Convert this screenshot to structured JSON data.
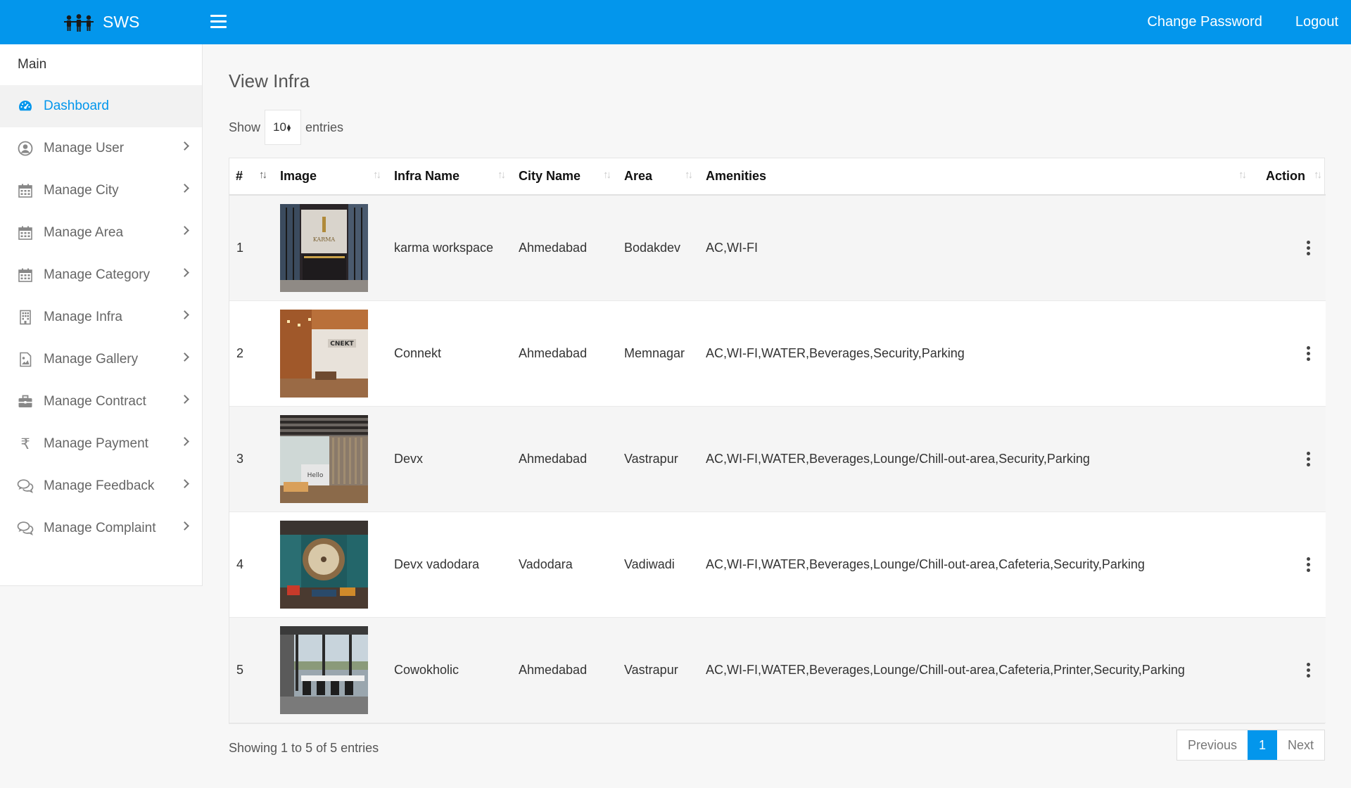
{
  "app": {
    "brand": "SWS",
    "top_links": [
      "Change Password",
      "Logout"
    ]
  },
  "sidebar": {
    "section_title": "Main",
    "items": [
      {
        "label": "Dashboard",
        "icon": "dashboard-icon",
        "active": true
      },
      {
        "label": "Manage User",
        "icon": "user-circle-icon"
      },
      {
        "label": "Manage City",
        "icon": "calendar-icon"
      },
      {
        "label": "Manage Area",
        "icon": "calendar-icon"
      },
      {
        "label": "Manage Category",
        "icon": "calendar-icon"
      },
      {
        "label": "Manage Infra",
        "icon": "building-icon"
      },
      {
        "label": "Manage Gallery",
        "icon": "image-file-icon"
      },
      {
        "label": "Manage Contract",
        "icon": "briefcase-icon"
      },
      {
        "label": "Manage Payment",
        "icon": "rupee-icon"
      },
      {
        "label": "Manage Feedback",
        "icon": "comments-icon"
      },
      {
        "label": "Manage Complaint",
        "icon": "comments-icon"
      }
    ]
  },
  "main": {
    "title": "View Infra",
    "length": {
      "prefix": "Show",
      "value": "10",
      "suffix": "entries"
    },
    "table": {
      "headers": [
        "#",
        "Image",
        "Infra Name",
        "City Name",
        "Area",
        "Amenities",
        "Action"
      ],
      "rows": [
        {
          "num": "1",
          "name": "karma workspace",
          "city": "Ahmedabad",
          "area": "Bodakdev",
          "amenities": "AC,WI-FI",
          "image": "photo-karma-workspace",
          "image_text": "KARMA"
        },
        {
          "num": "2",
          "name": "Connekt",
          "city": "Ahmedabad",
          "area": "Memnagar",
          "amenities": "AC,WI-FI,WATER,Beverages,Security,Parking",
          "image": "photo-connekt",
          "image_text": "CNEKT"
        },
        {
          "num": "3",
          "name": "Devx",
          "city": "Ahmedabad",
          "area": "Vastrapur",
          "amenities": "AC,WI-FI,WATER,Beverages,Lounge/Chill-out-area,Security,Parking",
          "image": "photo-devx",
          "image_text": "Hello"
        },
        {
          "num": "4",
          "name": "Devx vadodara",
          "city": "Vadodara",
          "area": "Vadiwadi",
          "amenities": "AC,WI-FI,WATER,Beverages,Lounge/Chill-out-area,Cafeteria,Security,Parking",
          "image": "photo-devx-vadodara"
        },
        {
          "num": "5",
          "name": "Cowokholic",
          "city": "Ahmedabad",
          "area": "Vastrapur",
          "amenities": "AC,WI-FI,WATER,Beverages,Lounge/Chill-out-area,Cafeteria,Printer,Security,Parking",
          "image": "photo-cowokholic"
        }
      ]
    },
    "info": "Showing 1 to 5 of 5 entries",
    "pagination": {
      "previous": "Previous",
      "current": "1",
      "next": "Next"
    }
  },
  "colors": {
    "accent": "#0396ec",
    "row_alt": "#f5f5f5"
  }
}
